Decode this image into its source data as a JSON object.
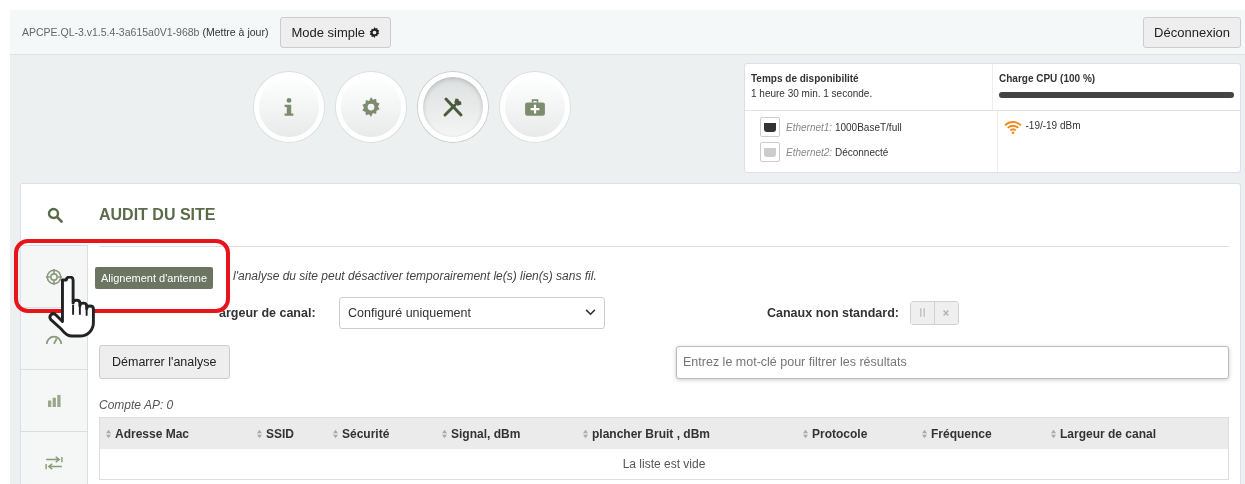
{
  "top_bar": {
    "version": "APCPE.QL-3.v1.5.4-3a615a0V1-968b",
    "update_link": "(Mettre à jour)",
    "mode_button": "Mode simple",
    "logout_button": "Déconnexion"
  },
  "nav": [
    {
      "kind": "info",
      "selected": false
    },
    {
      "kind": "gear",
      "selected": false
    },
    {
      "kind": "tools",
      "selected": true
    },
    {
      "kind": "medkit",
      "selected": false
    }
  ],
  "status": {
    "uptime_label": "Temps de disponibilité",
    "uptime_value": "1 heure 30 min. 1 seconde.",
    "cpu_label": "Charge CPU (100 %)",
    "level": 1.0,
    "ports": [
      {
        "name": "Ethernet1:",
        "value": "1000BaseT/full",
        "connected": true
      },
      {
        "name": "Ethernet2:",
        "value": "Déconnecté",
        "connected": false
      }
    ],
    "signal": "-19/-19 dBm"
  },
  "side_tabs": [
    {
      "kind": "search",
      "selected": true
    },
    {
      "kind": "target",
      "selected": false
    },
    {
      "kind": "gauge",
      "selected": false
    },
    {
      "kind": "bars",
      "selected": false
    },
    {
      "kind": "arrows",
      "selected": false
    }
  ],
  "tooltip": "Alignement d'antenne",
  "title": "AUDIT DU SITE",
  "warning": "l'analyse du site peut désactiver temporairement le(s) lien(s) sans fil.",
  "channel_width": {
    "label": "argeur de canal:",
    "value": "Configuré uniquement"
  },
  "non_standard": {
    "label": "Canaux non standard:",
    "on": false
  },
  "start_button": "Démarrer l'analyse",
  "filter": {
    "placeholder": "Entrez le mot-clé pour filtrer les résultats"
  },
  "ap_count": "Compte AP: 0",
  "table": {
    "columns": [
      "Adresse Mac",
      "SSID",
      "Sécurité",
      "Signal, dBm",
      "plancher Bruit , dBm",
      "Protocole",
      "Fréquence",
      "Largeur de canal"
    ],
    "empty": "La liste est vide"
  }
}
